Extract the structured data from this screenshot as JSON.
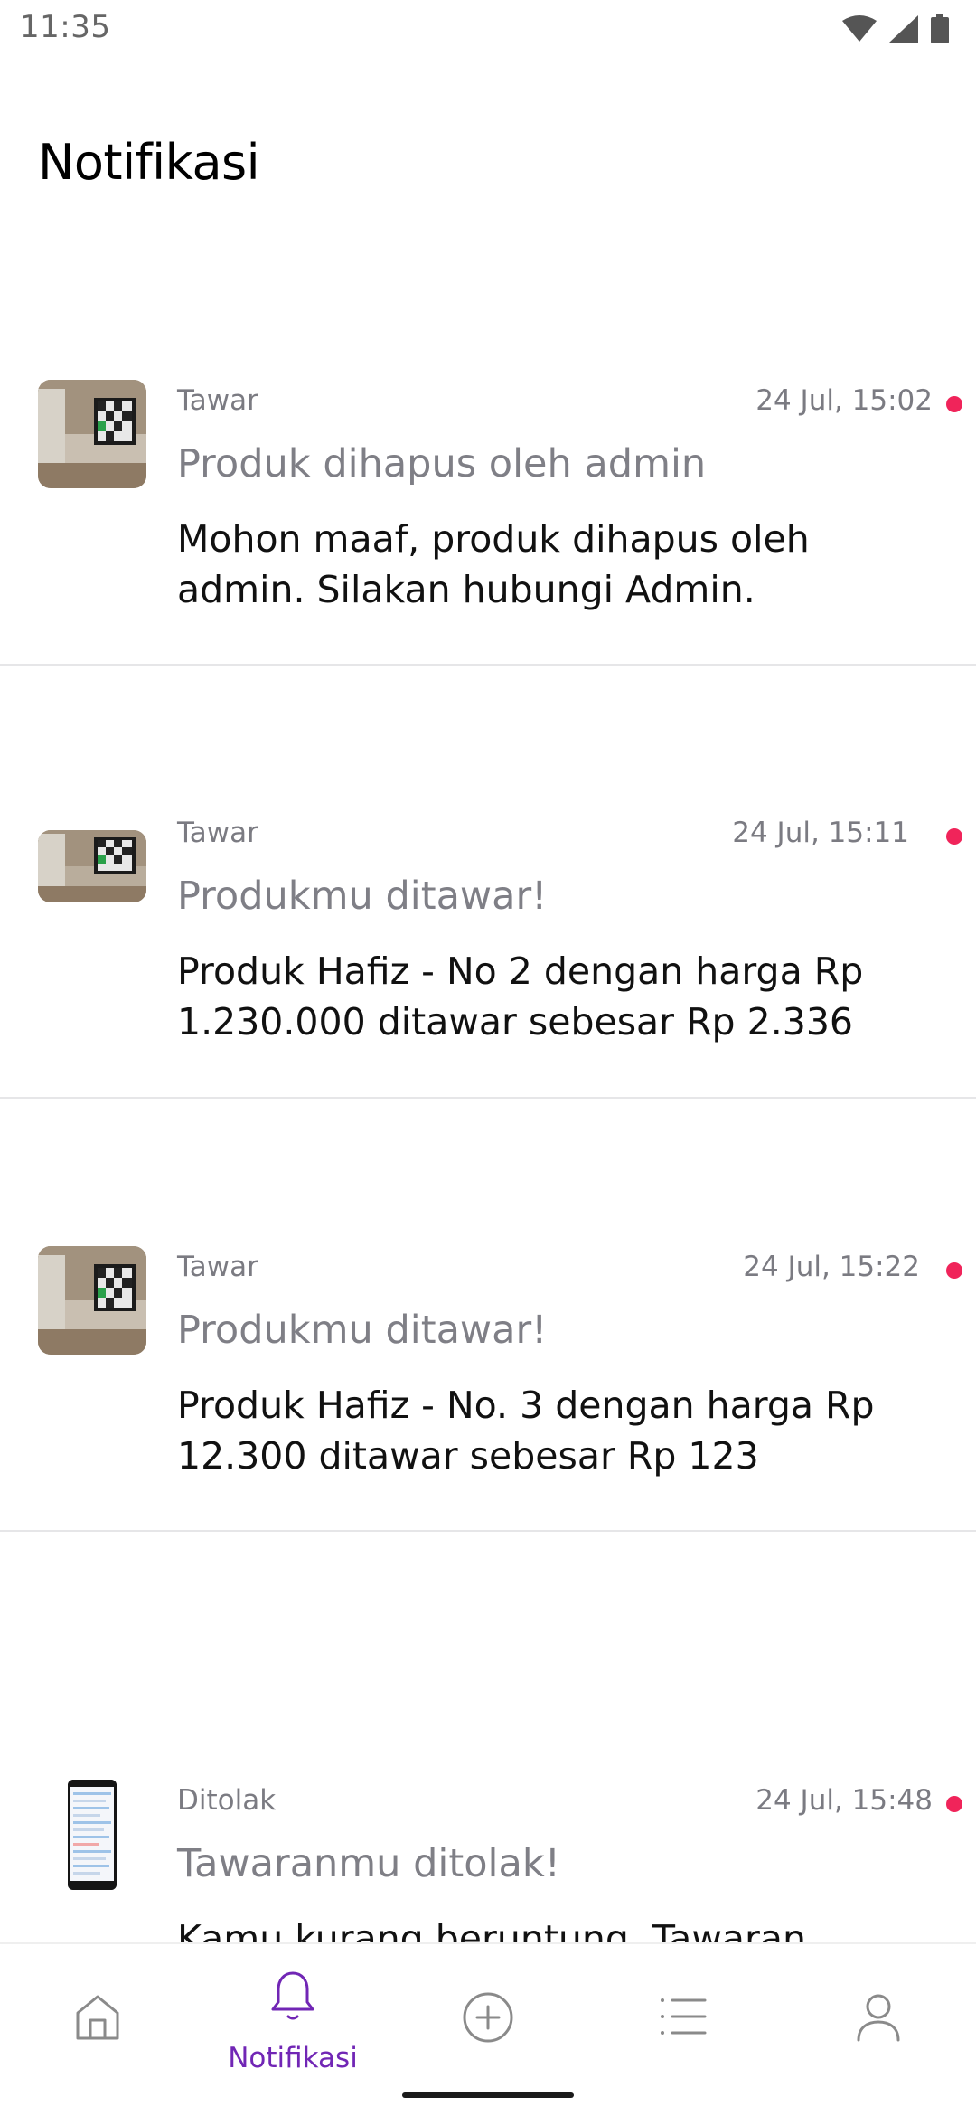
{
  "status_bar": {
    "time": "11:35",
    "icons": [
      "wifi-icon",
      "signal-icon",
      "battery-icon"
    ]
  },
  "header": {
    "title": "Notifikasi"
  },
  "notifications": [
    {
      "category": "Tawar",
      "time": "24 Jul, 15:02",
      "unread": true,
      "title": "Produk dihapus oleh admin",
      "body": "Mohon maaf, produk dihapus oleh admin. Silakan hubungi Admin.",
      "thumbnail": "tv-room-image"
    },
    {
      "category": "Tawar",
      "time": "24 Jul, 15:11",
      "unread": true,
      "title": "Produkmu ditawar!",
      "body": "Produk Hafiz - No 2 dengan harga Rp 1.230.000 ditawar sebesar Rp 2.336",
      "thumbnail": "tv-room-image"
    },
    {
      "category": "Tawar",
      "time": "24 Jul, 15:22",
      "unread": true,
      "title": "Produkmu ditawar!",
      "body": "Produk Hafiz - No. 3 dengan harga Rp 12.300 ditawar sebesar Rp 123",
      "thumbnail": "tv-room-image"
    },
    {
      "category": "Ditolak",
      "time": "24 Jul, 15:48",
      "unread": true,
      "title": "Tawaranmu ditolak!",
      "body": "Kamu kurang beruntung. Tawaran",
      "thumbnail": "phone-screenshot-image"
    }
  ],
  "bottom_nav": {
    "items": [
      {
        "name": "home",
        "icon": "home-icon",
        "label": ""
      },
      {
        "name": "notifikasi",
        "icon": "bell-icon",
        "label": "Notifikasi",
        "active": true
      },
      {
        "name": "jual",
        "icon": "plus-circle-icon",
        "label": ""
      },
      {
        "name": "daftar-jual",
        "icon": "list-icon",
        "label": ""
      },
      {
        "name": "akun",
        "icon": "user-icon",
        "label": ""
      }
    ]
  },
  "colors": {
    "accent": "#7126b5",
    "unread_dot": "#f0245a",
    "muted_text": "#7b7b82",
    "divider": "#e6e6e8"
  }
}
